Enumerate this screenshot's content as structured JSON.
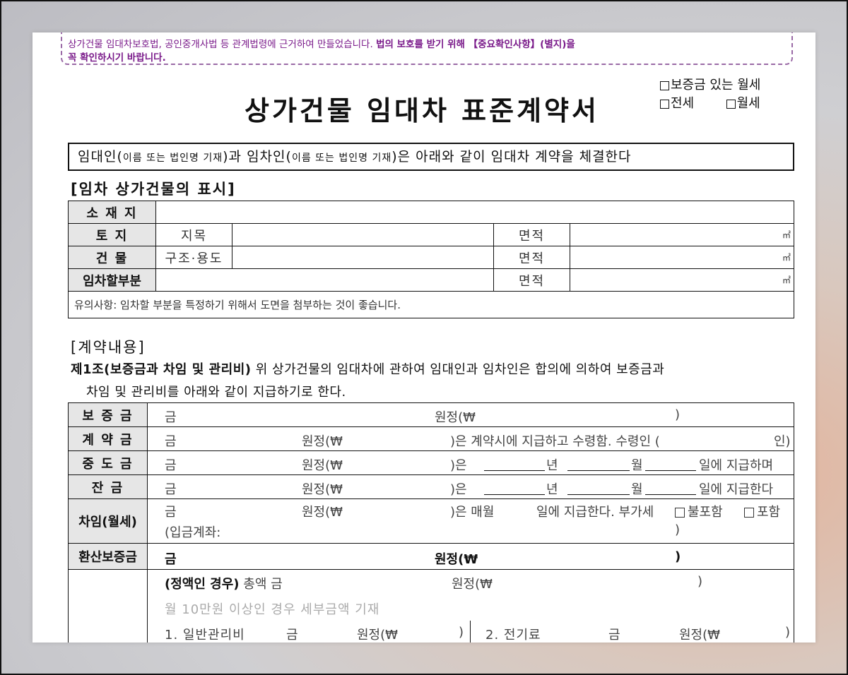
{
  "notice": {
    "line1": "상가건물 임대차보호법, 공인중개사법 등 관계법령에 근거하여 만들었습니다.",
    "line1_bold": "법의 보호를 받기 위해 【중요확인사항】(별지)을",
    "line2": "꼭 확인하시기 바랍니다."
  },
  "header": {
    "title": "상가건물 임대차 표준계약서",
    "type_1": "보증금 있는 월세",
    "type_2": "전세",
    "type_3": "월세"
  },
  "intro": {
    "p1": "임대인(",
    "p1_small": "이름 또는 법인명 기재",
    "p2": ")과 임차인(",
    "p2_small": "이름 또는 법인명 기재",
    "p3": ")은 아래와 같이 임대차 계약을 체결한다"
  },
  "property": {
    "section_title": "[임차 상가건물의 표시]",
    "row_location": "소 재 지",
    "row_land": "토   지",
    "row_building": "건   물",
    "row_part": "임차할부분",
    "land_category": "지목",
    "structure_use": "구조·용도",
    "area": "면적",
    "unit": "㎡",
    "note": "유의사항: 임차할 부분을 특정하기 위해서 도면을 첨부하는 것이 좋습니다."
  },
  "contract": {
    "section_title": "[계약내용]",
    "article1_title": "제1조(보증금과 차임 및 관리비)",
    "article1_text": "위 상가건물의 임대차에 관하여 임대인과 임차인은 합의에 의하여 보증금과",
    "article1_text2": "차임 및 관리비를 아래와 같이 지급하기로 한다."
  },
  "payment": {
    "deposit": "보 증 금",
    "contract_fee": "계 약 금",
    "interim": "중 도 금",
    "balance": "잔   금",
    "rent": "차임(월세)",
    "converted": "환산보증금",
    "geum": "금",
    "won": "원정(₩",
    "close": ")",
    "contract_tail": ")은 계약시에 지급하고 수령함. 수령인 (",
    "contract_in": "인)",
    "eun": ")은",
    "year": "년",
    "month": "월",
    "pay_interim": "일에 지급하며",
    "pay_balance": "일에 지급한다",
    "rent_tail": ")은  매월",
    "rent_day": "일에 지급한다. 부가세",
    "vat_excluded": "불포함",
    "vat_included": "포함",
    "account": "(입금계좌:",
    "fixed_case": "(정액인 경우)",
    "total": "총액  금",
    "detail_note": "월 10만원 이상인 경우 세부금액 기재",
    "general_fee": "1. 일반관리비",
    "electricity": "2. 전기료"
  }
}
